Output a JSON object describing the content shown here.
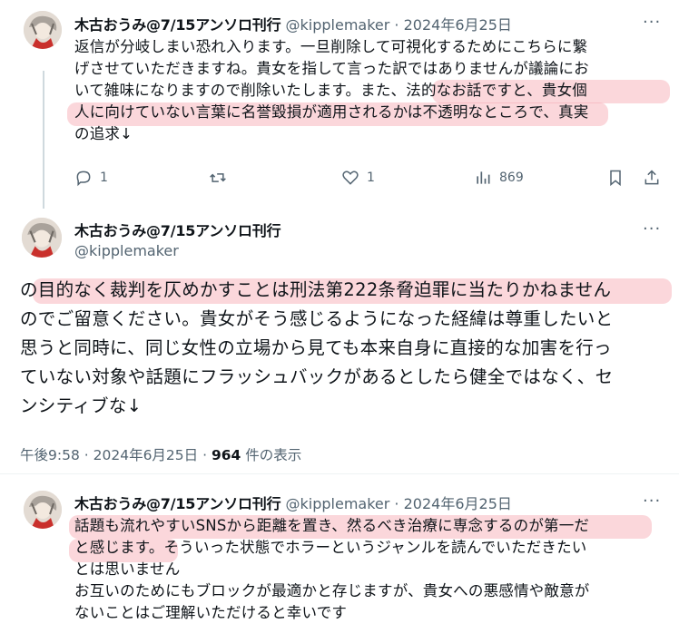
{
  "tweet1": {
    "name": "木古おうみ@7/15アンソロ刊行",
    "handle": "@kipplemaker",
    "sep": "·",
    "date": "2024年6月25日",
    "lines": [
      "返信が分岐しまい恐れ入ります。一旦削除して可視化するためにこちらに繋",
      "げさせていただきますね。貴女を指して言った訳ではありませんが議論にお",
      "いて雑味になりますので削除いたします。また、法的なお話ですと、貴女個",
      "人に向けていない言葉に名誉毀損が適用されるかは不透明なところで、真実",
      "の追求↓"
    ],
    "actions": {
      "reply": "1",
      "retweet": "",
      "like": "1",
      "views": "869"
    }
  },
  "tweet2": {
    "name": "木古おうみ@7/15アンソロ刊行",
    "handle": "@kipplemaker",
    "lines": [
      "の目的なく裁判を仄めかすことは刑法第222条脅迫罪に当たりかねません",
      "のでご留意ください。貴女がそう感じるようになった経緯は尊重したいと",
      "思うと同時に、同じ女性の立場から見ても本来自身に直接的な加害を行っ",
      "ていない対象や話題にフラッシュバックがあるとしたら健全ではなく、セ",
      "ンシティブな↓"
    ],
    "time": "午後9:58",
    "sep": "·",
    "date": "2024年6月25日",
    "views_count": "964",
    "views_label": "件の表示"
  },
  "tweet3": {
    "name": "木古おうみ@7/15アンソロ刊行",
    "handle": "@kipplemaker",
    "sep": "·",
    "date": "2024年6月25日",
    "lines": [
      "話題も流れやすいSNSから距離を置き、然るべき治療に専念するのが第一だ",
      "と感じます。そういった状態でホラーというジャンルを読んでいただきたい",
      "とは思いません",
      "お互いのためにもブロックが最適かと存じますが、貴女への悪感情や敵意が",
      "ないことはご理解いただけると幸いです"
    ]
  },
  "more_glyph": "···",
  "colors": {
    "text": "#0f1419",
    "secondary": "#536471",
    "highlight": "#f596a0",
    "divider": "#eff3f4"
  },
  "icons": [
    "reply-icon",
    "retweet-icon",
    "like-icon",
    "views-icon",
    "bookmark-icon",
    "share-icon",
    "more-icon"
  ]
}
